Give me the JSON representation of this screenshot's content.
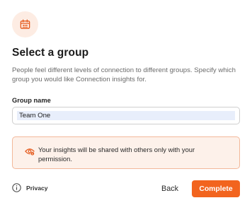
{
  "dialog": {
    "header_icon": "group-calendar-icon",
    "title": "Select a group",
    "subtitle": "People feel different levels of connection to different groups. Specify which group you would like Connection insights for."
  },
  "form": {
    "group_name_label": "Group name",
    "group_name_value": "Team One"
  },
  "notice": {
    "icon": "eye-privacy-icon",
    "text": "Your insights will be shared with others only with your permission."
  },
  "footer": {
    "privacy_icon": "info-circle-icon",
    "privacy_label": "Privacy",
    "back_label": "Back",
    "complete_label": "Complete"
  },
  "colors": {
    "accent": "#f2641e",
    "icon_bg": "#fdece3",
    "notice_bg": "#fdf1ea",
    "notice_border": "#f3b89a"
  }
}
